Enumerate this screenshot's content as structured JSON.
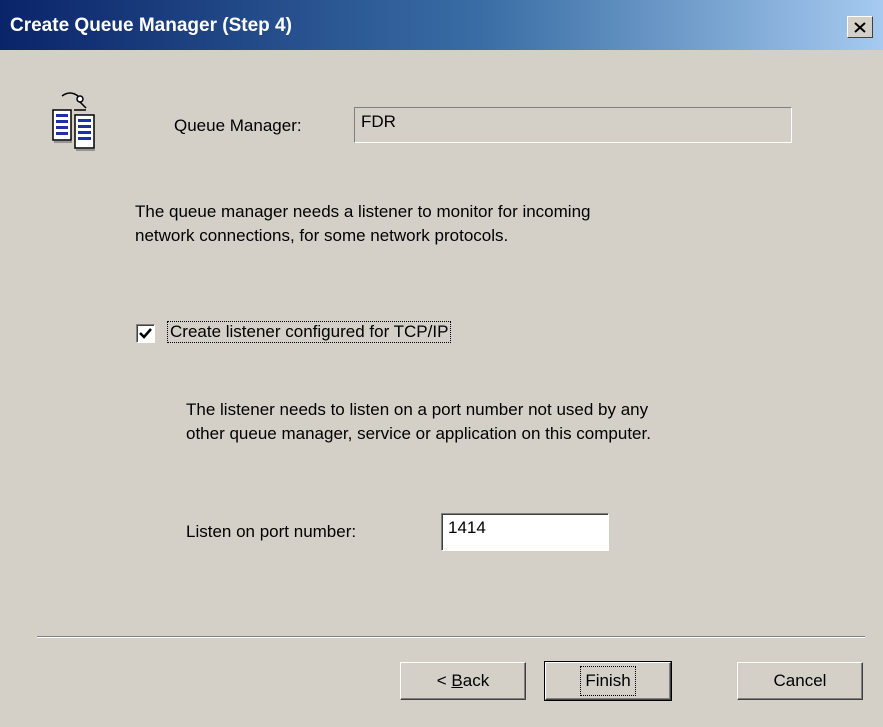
{
  "window": {
    "title": "Create Queue Manager (Step 4)"
  },
  "icons": {
    "close": "close-icon",
    "queue_manager": "queue-manager-icon"
  },
  "queue_manager": {
    "label": "Queue Manager:",
    "value": "FDR"
  },
  "intro_text": [
    "The queue manager needs a listener to monitor for incoming",
    "network connections, for some network protocols."
  ],
  "listener": {
    "checkbox_label": "Create listener configured for TCP/IP",
    "checked": true
  },
  "port_text": [
    "The listener needs to listen on a port number not used by any",
    "other queue manager, service or application on this computer."
  ],
  "port": {
    "label": "Listen on port number:",
    "value": "1414"
  },
  "buttons": {
    "back_prefix": "< ",
    "back_mnemonic": "B",
    "back_rest": "ack",
    "finish": "Finish",
    "cancel": "Cancel"
  }
}
